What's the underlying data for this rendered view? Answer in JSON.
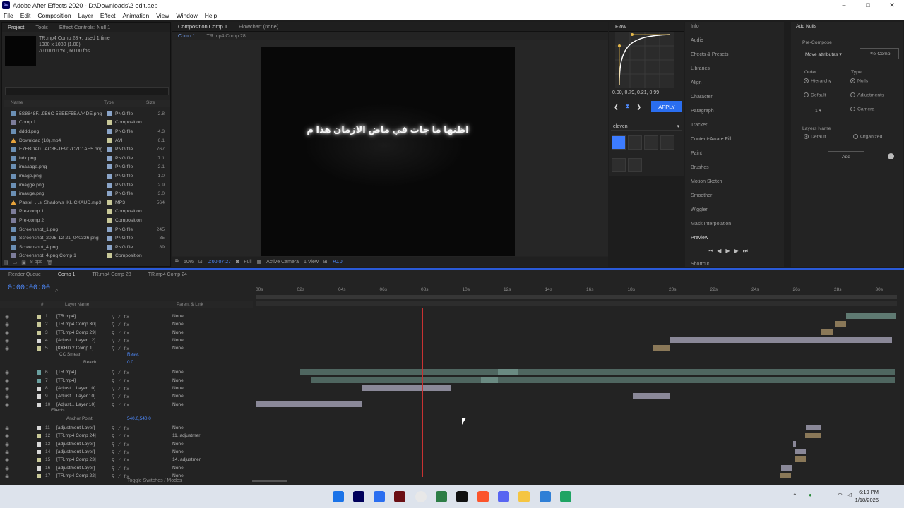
{
  "window": {
    "title": "Adobe After Effects 2020 - D:\\Downloads\\2 edit.aep",
    "app_icon": "Ae",
    "controls": [
      "–",
      "□",
      "✕"
    ]
  },
  "menu": [
    "File",
    "Edit",
    "Composition",
    "Layer",
    "Effect",
    "Animation",
    "View",
    "Window",
    "Help"
  ],
  "project": {
    "tabs": [
      "Project",
      "Tools",
      "Effect Controls: Null 1"
    ],
    "selected_name": "TR.mp4 Comp 28 ▾, used 1 time",
    "selected_dims": "1080 x 1080 (1.00)",
    "selected_dur": "Δ 0:00:01:50, 60.00 fps",
    "columns": [
      "Name",
      "Type",
      "Size"
    ],
    "items": [
      {
        "name": "5S8848F...9B6C-5SEEF5BAA4DE.png",
        "type": "PNG file",
        "size": "2.8",
        "kind": "png",
        "color": "#8aa4c8"
      },
      {
        "name": "Comp 1",
        "type": "Composition",
        "size": "",
        "kind": "comp",
        "color": "#c8c898"
      },
      {
        "name": "dddd.png",
        "type": "PNG file",
        "size": "4.3",
        "kind": "png",
        "color": "#8aa4c8"
      },
      {
        "name": "Download (18).mp4",
        "type": "AVI",
        "size": "6.1",
        "kind": "avi",
        "color": "#c8c898"
      },
      {
        "name": "E7EBDA0...AC86-1F907C7D1AE5.png",
        "type": "PNG file",
        "size": "767",
        "kind": "png",
        "color": "#8aa4c8"
      },
      {
        "name": "hdx.png",
        "type": "PNG file",
        "size": "7.1",
        "kind": "png",
        "color": "#8aa4c8"
      },
      {
        "name": "imaaage.png",
        "type": "PNG file",
        "size": "2.1",
        "kind": "png",
        "color": "#8aa4c8"
      },
      {
        "name": "image.png",
        "type": "PNG file",
        "size": "1.0",
        "kind": "png",
        "color": "#8aa4c8"
      },
      {
        "name": "imagge.png",
        "type": "PNG file",
        "size": "2.9",
        "kind": "png",
        "color": "#8aa4c8"
      },
      {
        "name": "imauge.png",
        "type": "PNG file",
        "size": "3.0",
        "kind": "png",
        "color": "#8aa4c8"
      },
      {
        "name": "Pastel_...s_Shadows_KLICKAUD.mp3",
        "type": "MP3",
        "size": "564",
        "kind": "avi",
        "color": "#c8c898"
      },
      {
        "name": "Pre-comp 1",
        "type": "Composition",
        "size": "",
        "kind": "comp",
        "color": "#c8c898"
      },
      {
        "name": "Pre-comp 2",
        "type": "Composition",
        "size": "",
        "kind": "comp",
        "color": "#c8c898"
      },
      {
        "name": "Screenshot_1.png",
        "type": "PNG file",
        "size": "245",
        "kind": "png",
        "color": "#8aa4c8"
      },
      {
        "name": "Screenshot_2025-12-21_040326.png",
        "type": "PNG file",
        "size": "35",
        "kind": "png",
        "color": "#8aa4c8"
      },
      {
        "name": "Screenshot_4.png",
        "type": "PNG file",
        "size": "89",
        "kind": "png",
        "color": "#8aa4c8"
      },
      {
        "name": "Screenshot_4.png Comp 1",
        "type": "Composition",
        "size": "",
        "kind": "comp",
        "color": "#c8c898"
      }
    ],
    "bottom": "8 bpc",
    "filter": "Filter"
  },
  "composition": {
    "tabs": [
      "Composition Comp 1",
      "Flowchart (none)"
    ],
    "subtabs": [
      "Comp 1",
      "TR.mp4 Comp 28"
    ],
    "viewer_text": "اظنها ما جات في ماض الازمان هذا م",
    "zoom": "50%",
    "timecode": "0:00:07:27",
    "resolution": "Full",
    "camera": "Active Camera",
    "view": "1 View",
    "exposure": "+0.0"
  },
  "flow": {
    "title": "Flow",
    "values": "0.00, 0.79, 0.21, 0.99",
    "apply": "APPLY",
    "preset": "eleven",
    "accent": "#2a6ef0"
  },
  "info_panel": {
    "items": [
      "Info",
      "Audio",
      "Effects & Presets",
      "Libraries",
      "Align",
      "Character",
      "Paragraph",
      "Tracker",
      "Content-Aware Fill",
      "Paint",
      "Brushes",
      "Motion Sketch",
      "Smoother",
      "Wiggler",
      "Mask Interpolation"
    ],
    "preview": "Preview",
    "shortcut": "Shortcut"
  },
  "add_nulls": {
    "title": "Add Nulls",
    "precompose": "Pre-Compose",
    "move_attrs": "Move attributes",
    "precomp_btn": "Pre-Comp",
    "order": "Order",
    "type": "Type",
    "hierarchy": "Hierarchy",
    "default": "Default",
    "nulls": "Nulls",
    "adjustments": "Adjustments",
    "camera": "Camera",
    "count": "1",
    "layers_name": "Layers Name",
    "organized": "Organized",
    "add": "Add"
  },
  "timeline": {
    "tabs": [
      "Render Queue",
      "Comp 1",
      "TR.mp4 Comp 28",
      "TR.mp4 Comp 24"
    ],
    "time": "0:00:00:00",
    "headers": [
      "#",
      "Layer Name",
      "Parent & Link"
    ],
    "ruler": [
      "00s",
      "02s",
      "04s",
      "06s",
      "08s",
      "10s",
      "12s",
      "14s",
      "16s",
      "18s",
      "20s",
      "22s",
      "24s",
      "26s",
      "28s",
      "30s"
    ],
    "layers": [
      {
        "num": "1",
        "name": "[TR.mp4]",
        "mode": "None",
        "color": "#c8c898"
      },
      {
        "num": "2",
        "name": "[TR.mp4 Comp 30]",
        "mode": "None",
        "color": "#c8c898"
      },
      {
        "num": "3",
        "name": "[TR.mp4 Comp 29]",
        "mode": "None",
        "color": "#c8c898"
      },
      {
        "num": "4",
        "name": "[Adjust... Layer 12]",
        "mode": "None",
        "color": "#d8d8d8"
      },
      {
        "num": "5",
        "name": "[KKHD 2 Comp 1]",
        "mode": "None",
        "color": "#c8c898"
      },
      {
        "num": "6",
        "name": "[TR.mp4]",
        "mode": "None",
        "color": "#6aa0a0"
      },
      {
        "num": "7",
        "name": "[TR.mp4]",
        "mode": "None",
        "color": "#6aa0a0"
      },
      {
        "num": "8",
        "name": "[Adjust... Layer 10]",
        "mode": "None",
        "color": "#d8d8d8"
      },
      {
        "num": "9",
        "name": "[Adjust... Layer 10]",
        "mode": "None",
        "color": "#d8d8d8"
      },
      {
        "num": "10",
        "name": "[Adjust... Layer 10]",
        "mode": "None",
        "color": "#d8d8d8"
      },
      {
        "num": "11",
        "name": "[adjustment Layer]",
        "mode": "None",
        "color": "#d8d8d8"
      },
      {
        "num": "12",
        "name": "[TR.mp4 Comp 24]",
        "mode": "11. adjustmer",
        "color": "#c8c898"
      },
      {
        "num": "13",
        "name": "[adjustment Layer]",
        "mode": "None",
        "color": "#d8d8d8"
      },
      {
        "num": "14",
        "name": "[adjustment Layer]",
        "mode": "None",
        "color": "#d8d8d8"
      },
      {
        "num": "15",
        "name": "[TR.mp4 Comp 23]",
        "mode": "14. adjustmer",
        "color": "#c8c898"
      },
      {
        "num": "16",
        "name": "[adjustment Layer]",
        "mode": "None",
        "color": "#d8d8d8"
      },
      {
        "num": "17",
        "name": "[TR.mp4 Comp 22]",
        "mode": "None",
        "color": "#c8c898"
      }
    ],
    "sub_cc_smear": "CC Smear",
    "sub_reset": "Reset",
    "sub_reach": "Reach",
    "sub_reach_val": "0.0",
    "sub_effects": "Effects",
    "sub_anchor": "Anchor Point",
    "sub_anchor_val": "540.0,540.0",
    "footer": "Toggle Switches / Modes"
  },
  "taskbar": {
    "time": "6:19 PM",
    "date": "1/18/2026"
  }
}
